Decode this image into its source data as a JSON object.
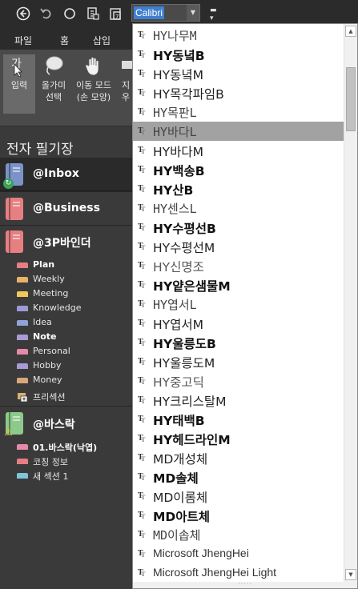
{
  "toolbar": {
    "font_value": "Calibri",
    "back_icon": "back-circle-icon",
    "undo_icon": "undo-icon",
    "circle_icon": "circle-icon",
    "sync_icon": "sync-page-icon",
    "page_icon": "page-icon"
  },
  "tabs": [
    "파일",
    "홈",
    "삽입"
  ],
  "ribbon": {
    "buttons": [
      {
        "label1": "입력",
        "label2": "",
        "icon": "type-cursor-icon"
      },
      {
        "label1": "올가미",
        "label2": "선택",
        "icon": "lasso-icon"
      },
      {
        "label1": "이동 모드",
        "label2": "(손 모양)",
        "icon": "hand-icon"
      },
      {
        "label1": "지우",
        "label2": "",
        "icon": "eraser-icon"
      }
    ]
  },
  "panel": {
    "title": "전자 필기장",
    "notebooks": [
      {
        "name": "@Inbox",
        "color": "#7b93c8",
        "badge": "sync"
      },
      {
        "name": "@Business",
        "color": "#e57f82",
        "badge": ""
      },
      {
        "name": "@3P바인더",
        "color": "#e57f82",
        "badge": ""
      },
      {
        "name": "@바스락",
        "color": "#8cc98a",
        "badge": "warning"
      }
    ],
    "binder_sections": [
      {
        "name": "Plan",
        "color": "#e57f82",
        "bold": true
      },
      {
        "name": "Weekly",
        "color": "#e8b26a",
        "bold": false
      },
      {
        "name": "Meeting",
        "color": "#f0c85a",
        "bold": false
      },
      {
        "name": "Knowledge",
        "color": "#9a9ad8",
        "bold": false
      },
      {
        "name": "Idea",
        "color": "#8fa3d8",
        "bold": false
      },
      {
        "name": "Note",
        "color": "#a89ad4",
        "bold": true
      },
      {
        "name": "Personal",
        "color": "#e58aa8",
        "bold": false
      },
      {
        "name": "Hobby",
        "color": "#a89ad4",
        "bold": false
      },
      {
        "name": "Money",
        "color": "#d8a87a",
        "bold": false
      },
      {
        "name": "프리섹션",
        "color": "",
        "bold": false
      }
    ],
    "basrak_sections": [
      {
        "name": "01.바스락(낙엽)",
        "color": "#e58aa8",
        "bold": true
      },
      {
        "name": "코칭 정보",
        "color": "#e57f82",
        "bold": false
      },
      {
        "name": "새 섹션 1",
        "color": "#7ec6d8",
        "bold": false
      }
    ]
  },
  "fonts": [
    {
      "name": "HY나무M",
      "style": "thin"
    },
    {
      "name": "HY동녘B",
      "style": "bold"
    },
    {
      "name": "HY동녘M",
      "style": "normal"
    },
    {
      "name": "HY목각파임B",
      "style": "normal"
    },
    {
      "name": "HY목판L",
      "style": "thin"
    },
    {
      "name": "HY바다L",
      "style": "thin"
    },
    {
      "name": "HY바다M",
      "style": "normal"
    },
    {
      "name": "HY백송B",
      "style": "bold"
    },
    {
      "name": "HY산B",
      "style": "bold"
    },
    {
      "name": "HY센스L",
      "style": "thin"
    },
    {
      "name": "HY수평선B",
      "style": "bold"
    },
    {
      "name": "HY수평선M",
      "style": "normal"
    },
    {
      "name": "HY신명조",
      "style": "light"
    },
    {
      "name": "HY얕은샘물M",
      "style": "bold"
    },
    {
      "name": "HY엽서L",
      "style": "thin"
    },
    {
      "name": "HY엽서M",
      "style": "normal"
    },
    {
      "name": "HY울릉도B",
      "style": "bold"
    },
    {
      "name": "HY울릉도M",
      "style": "normal"
    },
    {
      "name": "HY중고딕",
      "style": "light"
    },
    {
      "name": "HY크리스탈M",
      "style": "normal"
    },
    {
      "name": "HY태백B",
      "style": "bold"
    },
    {
      "name": "HY헤드라인M",
      "style": "bold"
    },
    {
      "name": "MD개성체",
      "style": "normal"
    },
    {
      "name": "MD솔체",
      "style": "bold"
    },
    {
      "name": "MD이롬체",
      "style": "normal"
    },
    {
      "name": "MD아트체",
      "style": "bold"
    },
    {
      "name": "MD이솝체",
      "style": "thin"
    },
    {
      "name": "Microsoft JhengHei",
      "style": "latin"
    },
    {
      "name": "Microsoft JhengHei Light",
      "style": "latin"
    }
  ],
  "highlighted_font_index": 5
}
